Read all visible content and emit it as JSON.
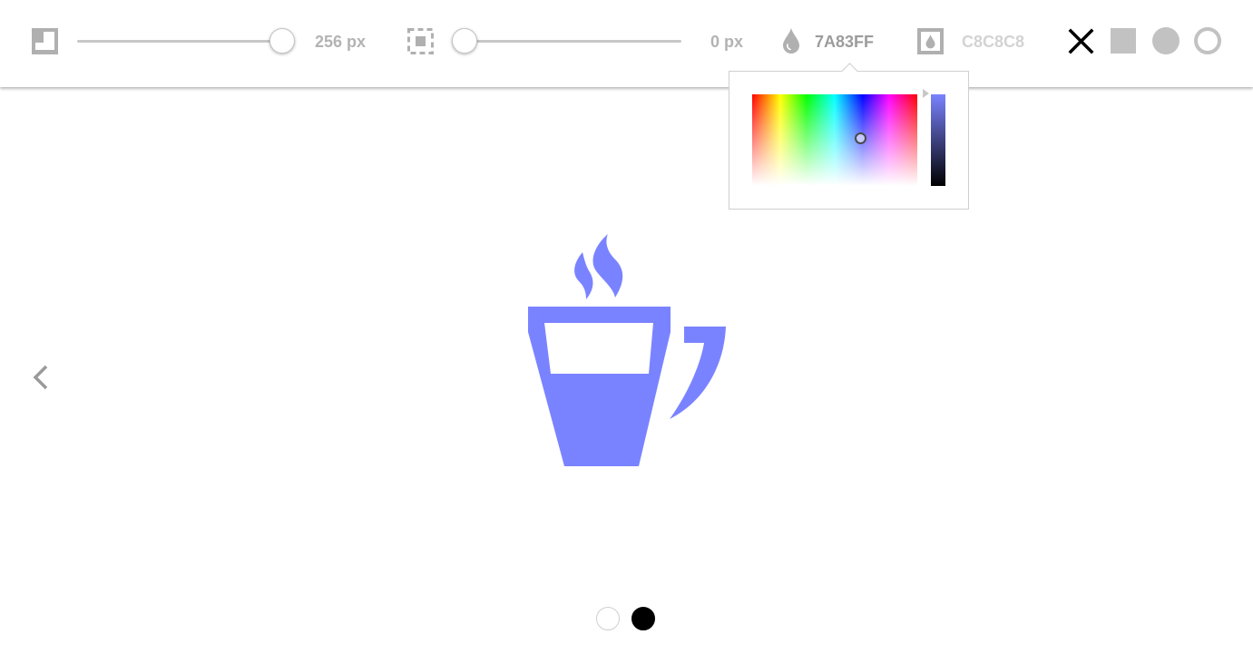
{
  "toolbar": {
    "size": {
      "value": 256,
      "min": 0,
      "max": 256,
      "label": "256 px"
    },
    "padding": {
      "value": 0,
      "min": 0,
      "max": 256,
      "label": "0 px"
    },
    "foreground": {
      "hex": "7A83FF",
      "color": "#7A83FF"
    },
    "background": {
      "hex": "C8C8C8",
      "color": "#C8C8C8"
    },
    "icons": {
      "size": "resize-square-icon",
      "padding": "padding-dashed-square-icon",
      "foreground": "droplet-icon",
      "background": "background-droplet-icon",
      "shape_none": "close-icon",
      "shape_square": "square-shape-icon",
      "shape_circle": "circle-shape-icon",
      "shape_ring": "ring-shape-icon"
    }
  },
  "color_picker": {
    "selected": "#7A83FF",
    "value_bar_top": "#7A83FF"
  },
  "preview": {
    "icon": "coffee-cup-icon",
    "color": "#7A83FF"
  },
  "navigation": {
    "prev_icon": "chevron-left-icon"
  },
  "theme_dots": [
    {
      "name": "light",
      "color": "#FFFFFF",
      "active": false
    },
    {
      "name": "dark",
      "color": "#000000",
      "active": true
    }
  ]
}
